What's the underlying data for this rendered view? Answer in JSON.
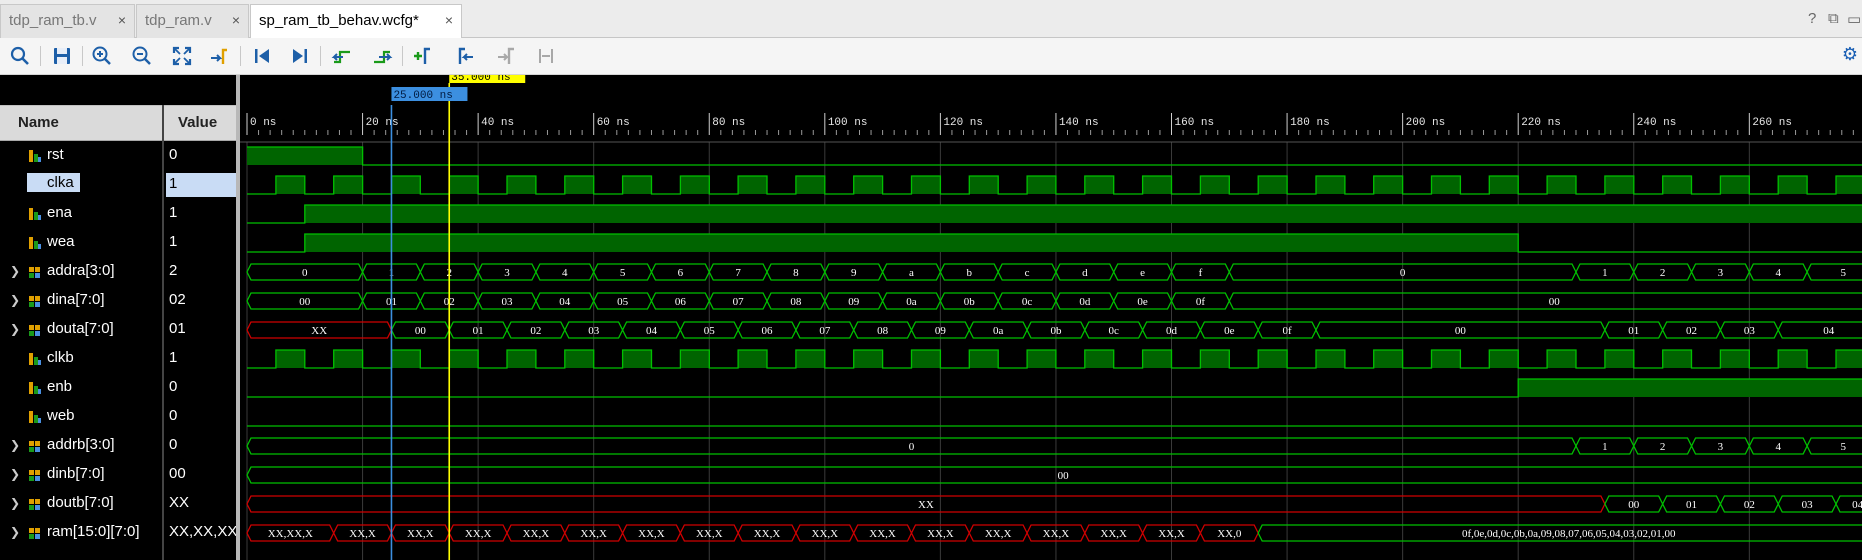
{
  "tabs": [
    {
      "label": "tdp_ram_tb.v",
      "close": "×",
      "active": false
    },
    {
      "label": "tdp_ram.v",
      "close": "×",
      "active": false
    },
    {
      "label": "sp_ram_tb_behav.wcfg*",
      "close": "×",
      "active": true
    }
  ],
  "window_icons": [
    "?",
    "⧉",
    "▭"
  ],
  "toolbar": [
    {
      "name": "search-icon",
      "tip": "Search"
    },
    {
      "name": "save-icon",
      "tip": "Save Waveform Configuration"
    },
    {
      "name": "zoom-in-icon",
      "tip": "Zoom In"
    },
    {
      "name": "zoom-out-icon",
      "tip": "Zoom Out"
    },
    {
      "name": "zoom-fit-icon",
      "tip": "Zoom Fit"
    },
    {
      "name": "go-to-cursor-icon",
      "tip": "Go To Cursor"
    },
    {
      "name": "go-to-time-0-icon",
      "tip": "Go To Time 0"
    },
    {
      "name": "go-to-last-time-icon",
      "tip": "Go To Last Time"
    },
    {
      "name": "previous-transition-icon",
      "tip": "Previous Transition"
    },
    {
      "name": "next-transition-icon",
      "tip": "Next Transition"
    },
    {
      "name": "add-marker-icon",
      "tip": "Add Marker"
    },
    {
      "name": "previous-marker-icon",
      "tip": "Previous Marker"
    },
    {
      "name": "next-marker-icon",
      "tip": "Next Marker"
    },
    {
      "name": "swap-cursors-icon",
      "tip": "Swap Cursors"
    }
  ],
  "headers": {
    "name": "Name",
    "value": "Value"
  },
  "signals": [
    {
      "name": "rst",
      "value": "0",
      "bus": false,
      "selected": false
    },
    {
      "name": "clka",
      "value": "1",
      "bus": false,
      "selected": true
    },
    {
      "name": "ena",
      "value": "1",
      "bus": false,
      "selected": false
    },
    {
      "name": "wea",
      "value": "1",
      "bus": false,
      "selected": false
    },
    {
      "name": "addra[3:0]",
      "value": "2",
      "bus": true,
      "selected": false
    },
    {
      "name": "dina[7:0]",
      "value": "02",
      "bus": true,
      "selected": false
    },
    {
      "name": "douta[7:0]",
      "value": "01",
      "bus": true,
      "selected": false
    },
    {
      "name": "clkb",
      "value": "1",
      "bus": false,
      "selected": false
    },
    {
      "name": "enb",
      "value": "0",
      "bus": false,
      "selected": false
    },
    {
      "name": "web",
      "value": "0",
      "bus": false,
      "selected": false
    },
    {
      "name": "addrb[3:0]",
      "value": "0",
      "bus": true,
      "selected": false
    },
    {
      "name": "dinb[7:0]",
      "value": "00",
      "bus": true,
      "selected": false
    },
    {
      "name": "doutb[7:0]",
      "value": "XX",
      "bus": true,
      "selected": false
    },
    {
      "name": "ram[15:0][7:0]",
      "value": "XX,XX,XX,X",
      "bus": true,
      "selected": false
    }
  ],
  "timeline": {
    "unit": "ns",
    "ticks": [
      0,
      20,
      40,
      60,
      80,
      100,
      120,
      140,
      160,
      180,
      200,
      220,
      240,
      260
    ],
    "minor_step": 2,
    "view_end_ns": 279.5
  },
  "markers": {
    "cursor": {
      "label": "35.000 ns",
      "time": 35,
      "color": "#ffff00"
    },
    "marker": {
      "label": "25.000 ns",
      "time": 25,
      "color": "#3c8fe0"
    }
  },
  "colors": {
    "wave": "#00c000",
    "fill": "#006400",
    "xstate": "#d00000",
    "grid": "#3a3a3a",
    "text": "#ffffff"
  },
  "waves": {
    "rst": {
      "init": 1,
      "edges": [
        20
      ]
    },
    "clka": {
      "period": 10,
      "first_rise": 5
    },
    "ena": {
      "init": 0,
      "edges": [
        10
      ]
    },
    "wea": {
      "init": 0,
      "edges": [
        10,
        220
      ]
    },
    "clkb": {
      "period": 10,
      "first_rise": 5
    },
    "enb": {
      "init": 0,
      "edges": [
        220
      ]
    },
    "web": {
      "init": 0,
      "edges": []
    },
    "addra": [
      {
        "t": 0,
        "v": "0"
      },
      {
        "t": 20,
        "v": "1"
      },
      {
        "t": 30,
        "v": "2"
      },
      {
        "t": 40,
        "v": "3"
      },
      {
        "t": 50,
        "v": "4"
      },
      {
        "t": 60,
        "v": "5"
      },
      {
        "t": 70,
        "v": "6"
      },
      {
        "t": 80,
        "v": "7"
      },
      {
        "t": 90,
        "v": "8"
      },
      {
        "t": 100,
        "v": "9"
      },
      {
        "t": 110,
        "v": "a"
      },
      {
        "t": 120,
        "v": "b"
      },
      {
        "t": 130,
        "v": "c"
      },
      {
        "t": 140,
        "v": "d"
      },
      {
        "t": 150,
        "v": "e"
      },
      {
        "t": 160,
        "v": "f"
      },
      {
        "t": 170,
        "v": "0"
      },
      {
        "t": 230,
        "v": "1"
      },
      {
        "t": 240,
        "v": "2"
      },
      {
        "t": 250,
        "v": "3"
      },
      {
        "t": 260,
        "v": "4"
      },
      {
        "t": 270,
        "v": "5"
      }
    ],
    "dina": [
      {
        "t": 0,
        "v": "00"
      },
      {
        "t": 20,
        "v": "01"
      },
      {
        "t": 30,
        "v": "02"
      },
      {
        "t": 40,
        "v": "03"
      },
      {
        "t": 50,
        "v": "04"
      },
      {
        "t": 60,
        "v": "05"
      },
      {
        "t": 70,
        "v": "06"
      },
      {
        "t": 80,
        "v": "07"
      },
      {
        "t": 90,
        "v": "08"
      },
      {
        "t": 100,
        "v": "09"
      },
      {
        "t": 110,
        "v": "0a"
      },
      {
        "t": 120,
        "v": "0b"
      },
      {
        "t": 130,
        "v": "0c"
      },
      {
        "t": 140,
        "v": "0d"
      },
      {
        "t": 150,
        "v": "0e"
      },
      {
        "t": 160,
        "v": "0f"
      },
      {
        "t": 170,
        "v": "00"
      }
    ],
    "douta": [
      {
        "t": 0,
        "v": "XX",
        "x": true
      },
      {
        "t": 25,
        "v": "00"
      },
      {
        "t": 35,
        "v": "01"
      },
      {
        "t": 45,
        "v": "02"
      },
      {
        "t": 55,
        "v": "03"
      },
      {
        "t": 65,
        "v": "04"
      },
      {
        "t": 75,
        "v": "05"
      },
      {
        "t": 85,
        "v": "06"
      },
      {
        "t": 95,
        "v": "07"
      },
      {
        "t": 105,
        "v": "08"
      },
      {
        "t": 115,
        "v": "09"
      },
      {
        "t": 125,
        "v": "0a"
      },
      {
        "t": 135,
        "v": "0b"
      },
      {
        "t": 145,
        "v": "0c"
      },
      {
        "t": 155,
        "v": "0d"
      },
      {
        "t": 165,
        "v": "0e"
      },
      {
        "t": 175,
        "v": "0f"
      },
      {
        "t": 185,
        "v": "00"
      },
      {
        "t": 235,
        "v": "01"
      },
      {
        "t": 245,
        "v": "02"
      },
      {
        "t": 255,
        "v": "03"
      },
      {
        "t": 265,
        "v": "04"
      }
    ],
    "addrb": [
      {
        "t": 0,
        "v": "0"
      },
      {
        "t": 230,
        "v": "1"
      },
      {
        "t": 240,
        "v": "2"
      },
      {
        "t": 250,
        "v": "3"
      },
      {
        "t": 260,
        "v": "4"
      },
      {
        "t": 270,
        "v": "5"
      }
    ],
    "dinb": [
      {
        "t": 0,
        "v": "00"
      }
    ],
    "doutb": [
      {
        "t": 0,
        "v": "XX",
        "x": true
      },
      {
        "t": 235,
        "v": "00"
      },
      {
        "t": 245,
        "v": "01"
      },
      {
        "t": 255,
        "v": "02"
      },
      {
        "t": 265,
        "v": "03"
      },
      {
        "t": 275,
        "v": "04"
      }
    ],
    "ram": [
      {
        "t": 0,
        "v": "XX,XX,X",
        "x": true
      },
      {
        "t": 15,
        "v": "XX,X",
        "x": true
      },
      {
        "t": 25,
        "v": "XX,X",
        "x": true
      },
      {
        "t": 35,
        "v": "XX,X",
        "x": true
      },
      {
        "t": 45,
        "v": "XX,X",
        "x": true
      },
      {
        "t": 55,
        "v": "XX,X",
        "x": true
      },
      {
        "t": 65,
        "v": "XX,X",
        "x": true
      },
      {
        "t": 75,
        "v": "XX,X",
        "x": true
      },
      {
        "t": 85,
        "v": "XX,X",
        "x": true
      },
      {
        "t": 95,
        "v": "XX,X",
        "x": true
      },
      {
        "t": 105,
        "v": "XX,X",
        "x": true
      },
      {
        "t": 115,
        "v": "XX,X",
        "x": true
      },
      {
        "t": 125,
        "v": "XX,X",
        "x": true
      },
      {
        "t": 135,
        "v": "XX,X",
        "x": true
      },
      {
        "t": 145,
        "v": "XX,X",
        "x": true
      },
      {
        "t": 155,
        "v": "XX,X",
        "x": true
      },
      {
        "t": 165,
        "v": "XX,0",
        "x": true
      },
      {
        "t": 175,
        "v": "0f,0e,0d,0c,0b,0a,09,08,07,06,05,04,03,02,01,00"
      }
    ]
  }
}
